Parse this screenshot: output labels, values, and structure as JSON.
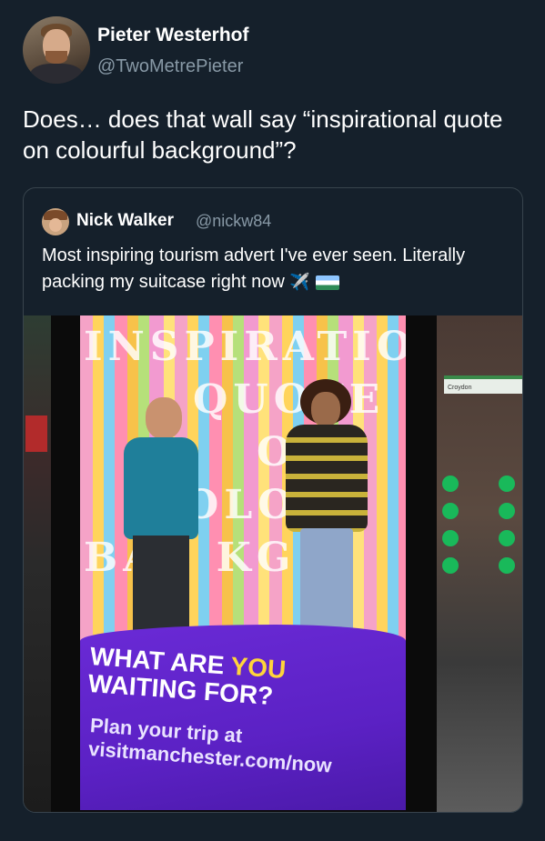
{
  "author": {
    "name": "Pieter Westerhof",
    "handle": "@TwoMetrePieter"
  },
  "tweet": {
    "text": "Does… does that wall say “inspirational quote on colourful background”?"
  },
  "quoted": {
    "name": "Nick Walker",
    "handle": "@nickw84",
    "text": "Most inspiring tourism advert I've ever seen. Literally packing my suitcase right now",
    "emoji": "✈️"
  },
  "poster": {
    "wall_text_lines": [
      "INSPIRATIO",
      "QUOTE",
      "O",
      "OLO   F",
      "BAC KG   O"
    ],
    "headline_part1": "WHAT ARE ",
    "headline_highlight": "YOU",
    "headline_part2": "WAITING FOR?",
    "cta_line1": "Plan your trip at",
    "cta_line2": "visitmanchester.com/now",
    "sign_text": "Croydon"
  },
  "colors": {
    "background": "#15202b",
    "secondary_text": "#8899a6",
    "border": "#38444d",
    "poster_purple": "#5b21c4",
    "highlight_yellow": "#ffd43b"
  }
}
